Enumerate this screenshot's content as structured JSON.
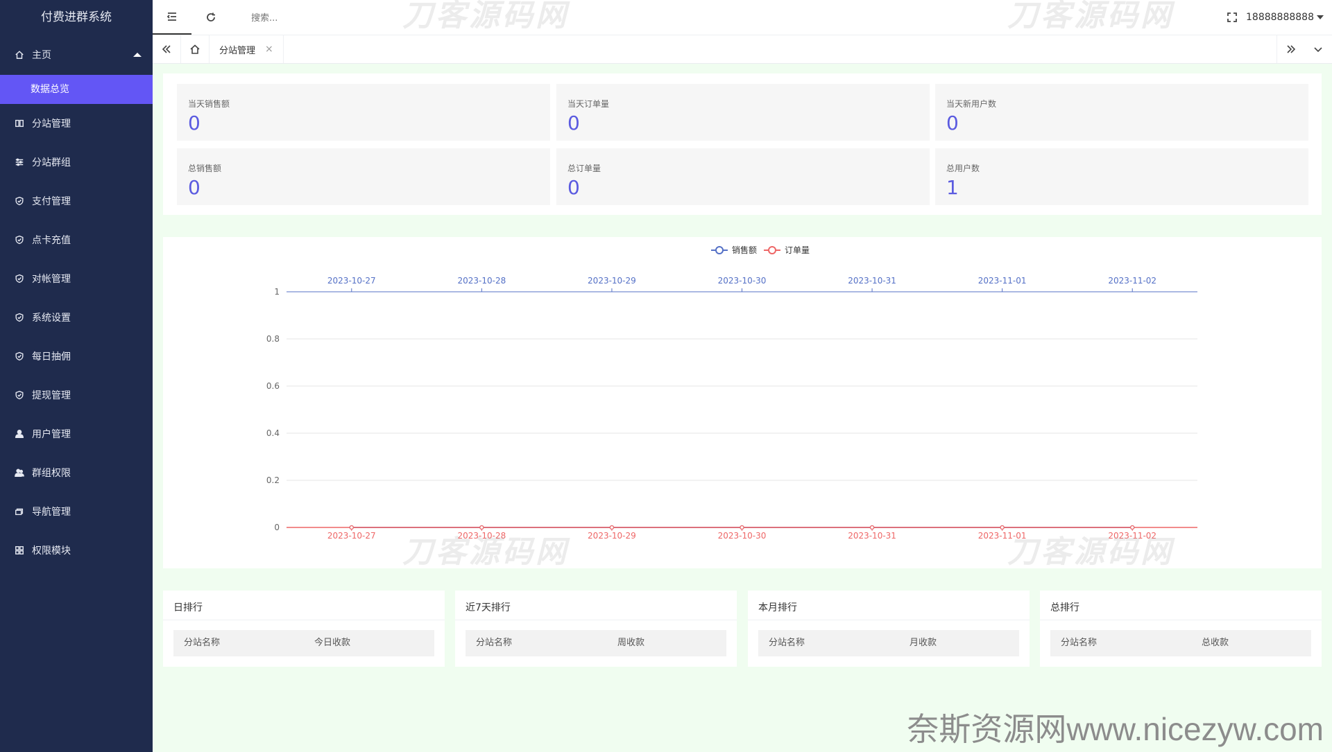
{
  "app": {
    "title": "付费进群系统"
  },
  "sidebar": {
    "home": {
      "label": "主页"
    },
    "sub_active": {
      "label": "数据总览"
    },
    "items": [
      {
        "label": "分站管理",
        "icon": "columns-icon"
      },
      {
        "label": "分站群组",
        "icon": "sliders-icon"
      },
      {
        "label": "支付管理",
        "icon": "shield-check-icon"
      },
      {
        "label": "点卡充值",
        "icon": "shield-check-icon"
      },
      {
        "label": "对帐管理",
        "icon": "shield-check-icon"
      },
      {
        "label": "系统设置",
        "icon": "shield-check-icon"
      },
      {
        "label": "每日抽佣",
        "icon": "shield-check-icon"
      },
      {
        "label": "提现管理",
        "icon": "shield-check-icon"
      },
      {
        "label": "用户管理",
        "icon": "user-icon"
      },
      {
        "label": "群组权限",
        "icon": "users-icon"
      },
      {
        "label": "导航管理",
        "icon": "layers-icon"
      },
      {
        "label": "权限模块",
        "icon": "grid-icon"
      }
    ]
  },
  "header": {
    "search_placeholder": "搜索...",
    "user": "18888888888"
  },
  "tabs": {
    "items": [
      {
        "label": "分站管理",
        "close": "×"
      }
    ]
  },
  "stats": [
    {
      "label": "当天销售额",
      "value": "0"
    },
    {
      "label": "当天订单量",
      "value": "0"
    },
    {
      "label": "当天新用户数",
      "value": "0"
    },
    {
      "label": "总销售额",
      "value": "0"
    },
    {
      "label": "总订单量",
      "value": "0"
    },
    {
      "label": "总用户数",
      "value": "1"
    }
  ],
  "chart_data": {
    "type": "line",
    "x": [
      "2023-10-27",
      "2023-10-28",
      "2023-10-29",
      "2023-10-30",
      "2023-10-31",
      "2023-11-01",
      "2023-11-02"
    ],
    "series": [
      {
        "name": "销售额",
        "color": "#5470c6",
        "values": [
          0,
          0,
          0,
          0,
          0,
          0,
          0
        ]
      },
      {
        "name": "订单量",
        "color": "#ee6666",
        "values": [
          0,
          0,
          0,
          0,
          0,
          0,
          0
        ]
      }
    ],
    "ylim": [
      0,
      1
    ],
    "yticks": [
      "1",
      "0.8",
      "0.6",
      "0.4",
      "0.2",
      "0"
    ],
    "legend": "top-center",
    "grid": true
  },
  "rankings": [
    {
      "title": "日排行",
      "col1": "分站名称",
      "col2": "今日收款"
    },
    {
      "title": "近7天排行",
      "col1": "分站名称",
      "col2": "周收款"
    },
    {
      "title": "本月排行",
      "col1": "分站名称",
      "col2": "月收款"
    },
    {
      "title": "总排行",
      "col1": "分站名称",
      "col2": "总收款"
    }
  ],
  "watermarks": {
    "cn": "刀客源码网",
    "site": "奈斯资源网www.nicezyw.com"
  }
}
